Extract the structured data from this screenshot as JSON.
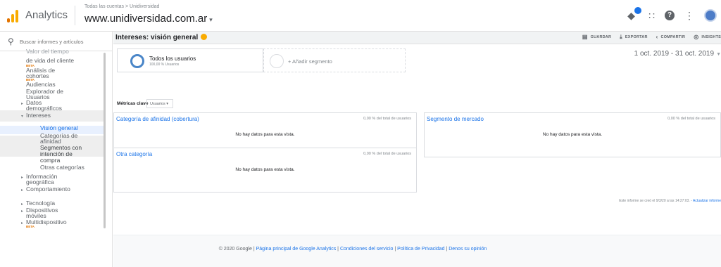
{
  "header": {
    "app_name": "Analytics",
    "breadcrumb": "Todas las cuentas > Unidiversidad",
    "account": "www.unidiversidad.com.ar",
    "account_caret": "▾"
  },
  "sidebar": {
    "search_placeholder": "Buscar informes y artículos",
    "items": [
      {
        "label": "Valor del tiempo",
        "kind": "cut"
      },
      {
        "label": "de vida del cliente",
        "kind": "child"
      },
      {
        "label": "BETA",
        "kind": "beta"
      },
      {
        "label": "Análisis de",
        "kind": "child"
      },
      {
        "label": "cohortes",
        "kind": "child"
      },
      {
        "label": "BETA",
        "kind": "beta"
      },
      {
        "label": "Audiencias",
        "kind": "child"
      },
      {
        "label": "Explorador de",
        "kind": "child"
      },
      {
        "label": "Usuarios",
        "kind": "child"
      },
      {
        "label": "Datos",
        "kind": "group"
      },
      {
        "label": "demográficos",
        "kind": "child"
      },
      {
        "label": "Intereses",
        "kind": "open"
      },
      {
        "label": "Visión general",
        "kind": "active"
      },
      {
        "label": "Categorías de",
        "kind": "sub"
      },
      {
        "label": "afinidad",
        "kind": "sub"
      },
      {
        "label": "Segmentos con",
        "kind": "sub-hl"
      },
      {
        "label": "intención de",
        "kind": "sub-hl"
      },
      {
        "label": "compra",
        "kind": "sub-hl"
      },
      {
        "label": "Otras categorías",
        "kind": "sub"
      },
      {
        "label": "Información",
        "kind": "group"
      },
      {
        "label": "geográfica",
        "kind": "child"
      },
      {
        "label": "Comportamiento",
        "kind": "group"
      },
      {
        "label": "Tecnología",
        "kind": "group"
      },
      {
        "label": "Dispositivos",
        "kind": "group"
      },
      {
        "label": "móviles",
        "kind": "child"
      },
      {
        "label": "Multidispositivo",
        "kind": "group"
      },
      {
        "label": "BETA",
        "kind": "beta"
      }
    ]
  },
  "report": {
    "title": "Intereses: visión general",
    "actions": [
      {
        "icon": "save-icon",
        "label": "GUARDAR"
      },
      {
        "icon": "export-icon",
        "label": "EXPORTAR"
      },
      {
        "icon": "share-icon",
        "label": "COMPARTIR"
      },
      {
        "icon": "insights-icon",
        "label": "INSIGHTS"
      }
    ],
    "date_range": "1 oct. 2019 - 31 oct. 2019",
    "segment": {
      "name": "Todos los usuarios",
      "sub": "100,00 % Usuarios"
    },
    "add_segment": "+ Añadir segmento",
    "metrics_label": "Métricas clave",
    "metrics_value": "Usuarios",
    "cards": [
      {
        "title": "Categoría de afinidad (cobertura)",
        "meta": "0,00 % del total de usuarios",
        "empty": "No hay datos para esta vista."
      },
      {
        "title": "Segmento de mercado",
        "meta": "0,00 % del total de usuarios",
        "empty": "No hay datos para esta vista."
      },
      {
        "title": "Otra categoría",
        "meta": "0,00 % del total de usuarios",
        "empty": "No hay datos para esta vista."
      }
    ],
    "note": "Este informe se creó el 9/3/20 a las 14:27:03. -",
    "note_link": "Actualizar informe"
  },
  "footer": {
    "copyright": "© 2020 Google |",
    "links": [
      "Página principal de Google Analytics",
      "Condiciones del servicio",
      "Política de Privacidad",
      "Denos su opinión"
    ]
  },
  "colors": {
    "accent": "#1a73e8",
    "logo_orange": "#f9ab00",
    "logo_dark_orange": "#e37400",
    "active_bg": "#e8f0fe",
    "highlight_bg": "#eeeeee"
  }
}
